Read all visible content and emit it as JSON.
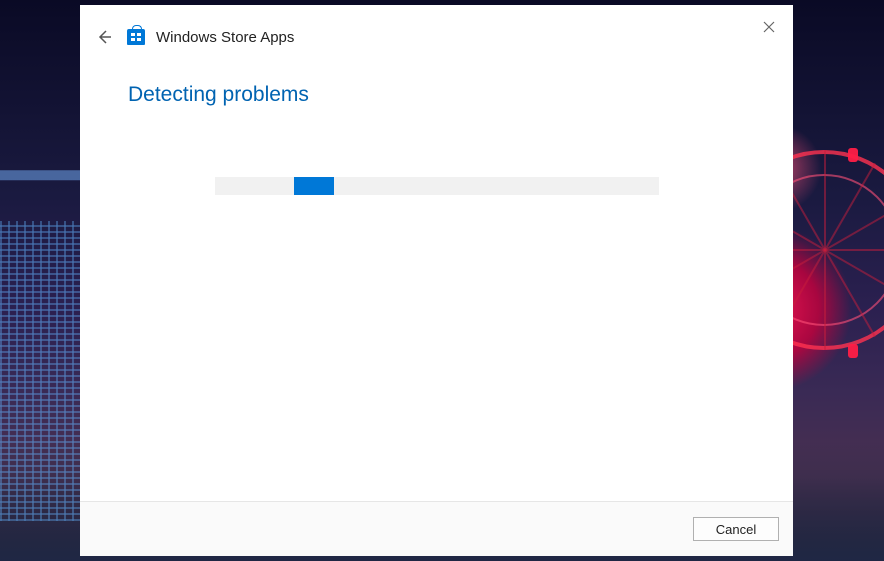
{
  "header": {
    "title": "Windows Store Apps",
    "icon": "store-bag-icon"
  },
  "content": {
    "heading": "Detecting problems",
    "progress": {
      "indeterminate": true,
      "fill_left_pct": 18,
      "fill_width_pct": 9
    }
  },
  "footer": {
    "cancel_label": "Cancel"
  },
  "colors": {
    "accent": "#0078d7",
    "heading": "#0063b1"
  }
}
